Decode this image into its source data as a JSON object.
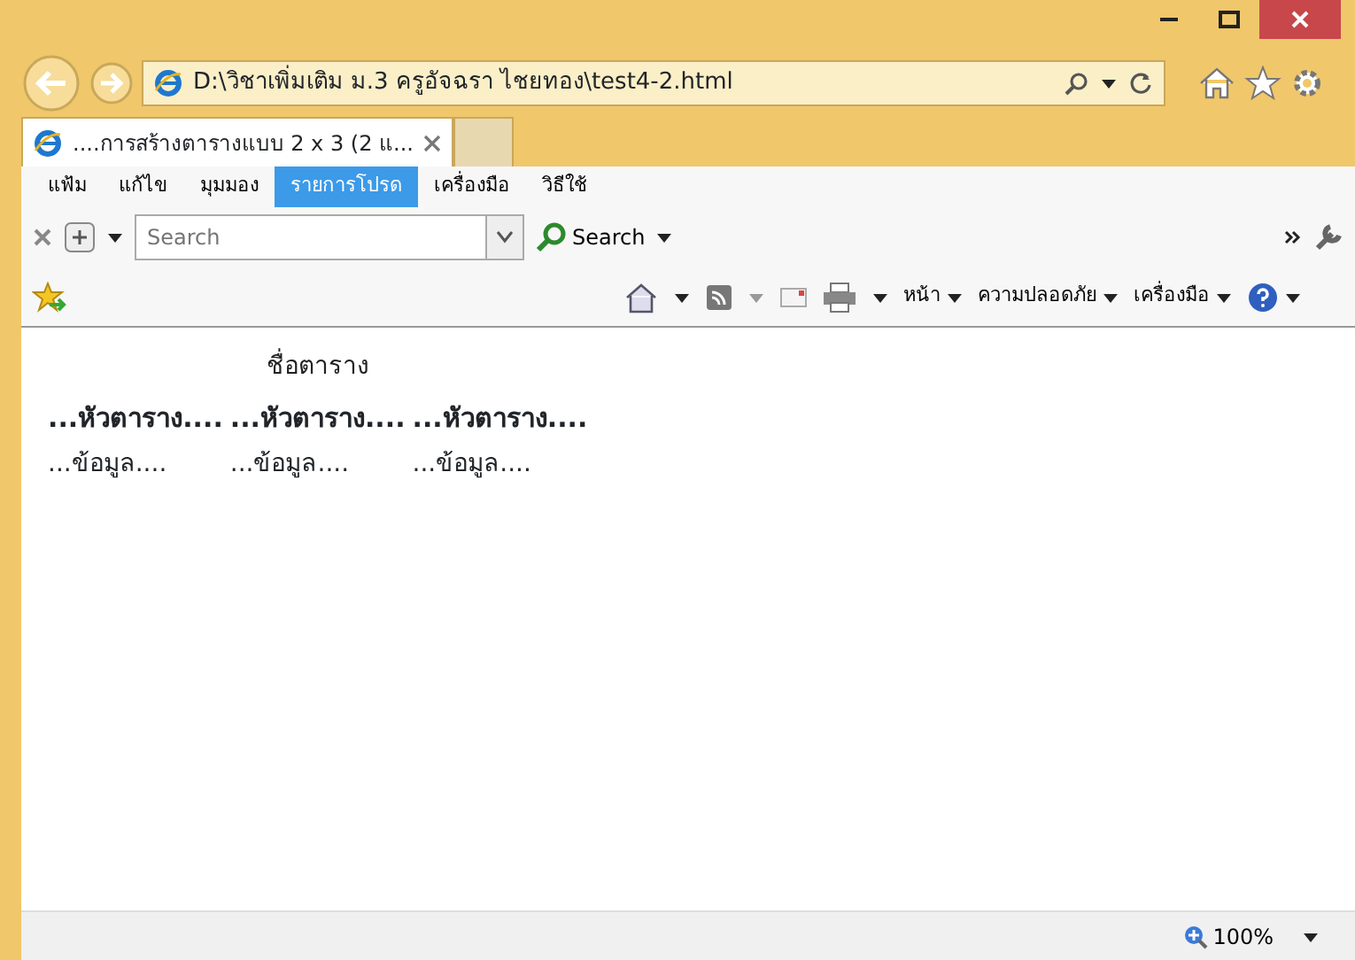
{
  "address_bar": {
    "url": "D:\\วิชาเพิ่มเติม ม.3 ครูอัจฉรา ไชยทอง\\test4-2.html"
  },
  "tabs": [
    {
      "label": "....การสร้างตารางแบบ 2 x 3 (2 แ...",
      "selected": true
    }
  ],
  "menu": [
    {
      "label": "แฟ้ม",
      "selected": false
    },
    {
      "label": "แก้ไข",
      "selected": false
    },
    {
      "label": "มุมมอง",
      "selected": false
    },
    {
      "label": "รายการโปรด",
      "selected": true
    },
    {
      "label": "เครื่องมือ",
      "selected": false
    },
    {
      "label": "วิธีใช้",
      "selected": false
    }
  ],
  "search_toolbar": {
    "placeholder": "Search",
    "button": "Search"
  },
  "command_bar": [
    {
      "label": "หน้า"
    },
    {
      "label": "ความปลอดภัย"
    },
    {
      "label": "เครื่องมือ"
    }
  ],
  "page": {
    "caption": "ชื่อตาราง",
    "headers": [
      "...หัวตาราง....",
      "...หัวตาราง....",
      "...หัวตาราง...."
    ],
    "rows": [
      [
        "...ข้อมูล....",
        "...ข้อมูล....",
        "...ข้อมูล...."
      ]
    ]
  },
  "status_bar": {
    "zoom": "100%"
  }
}
